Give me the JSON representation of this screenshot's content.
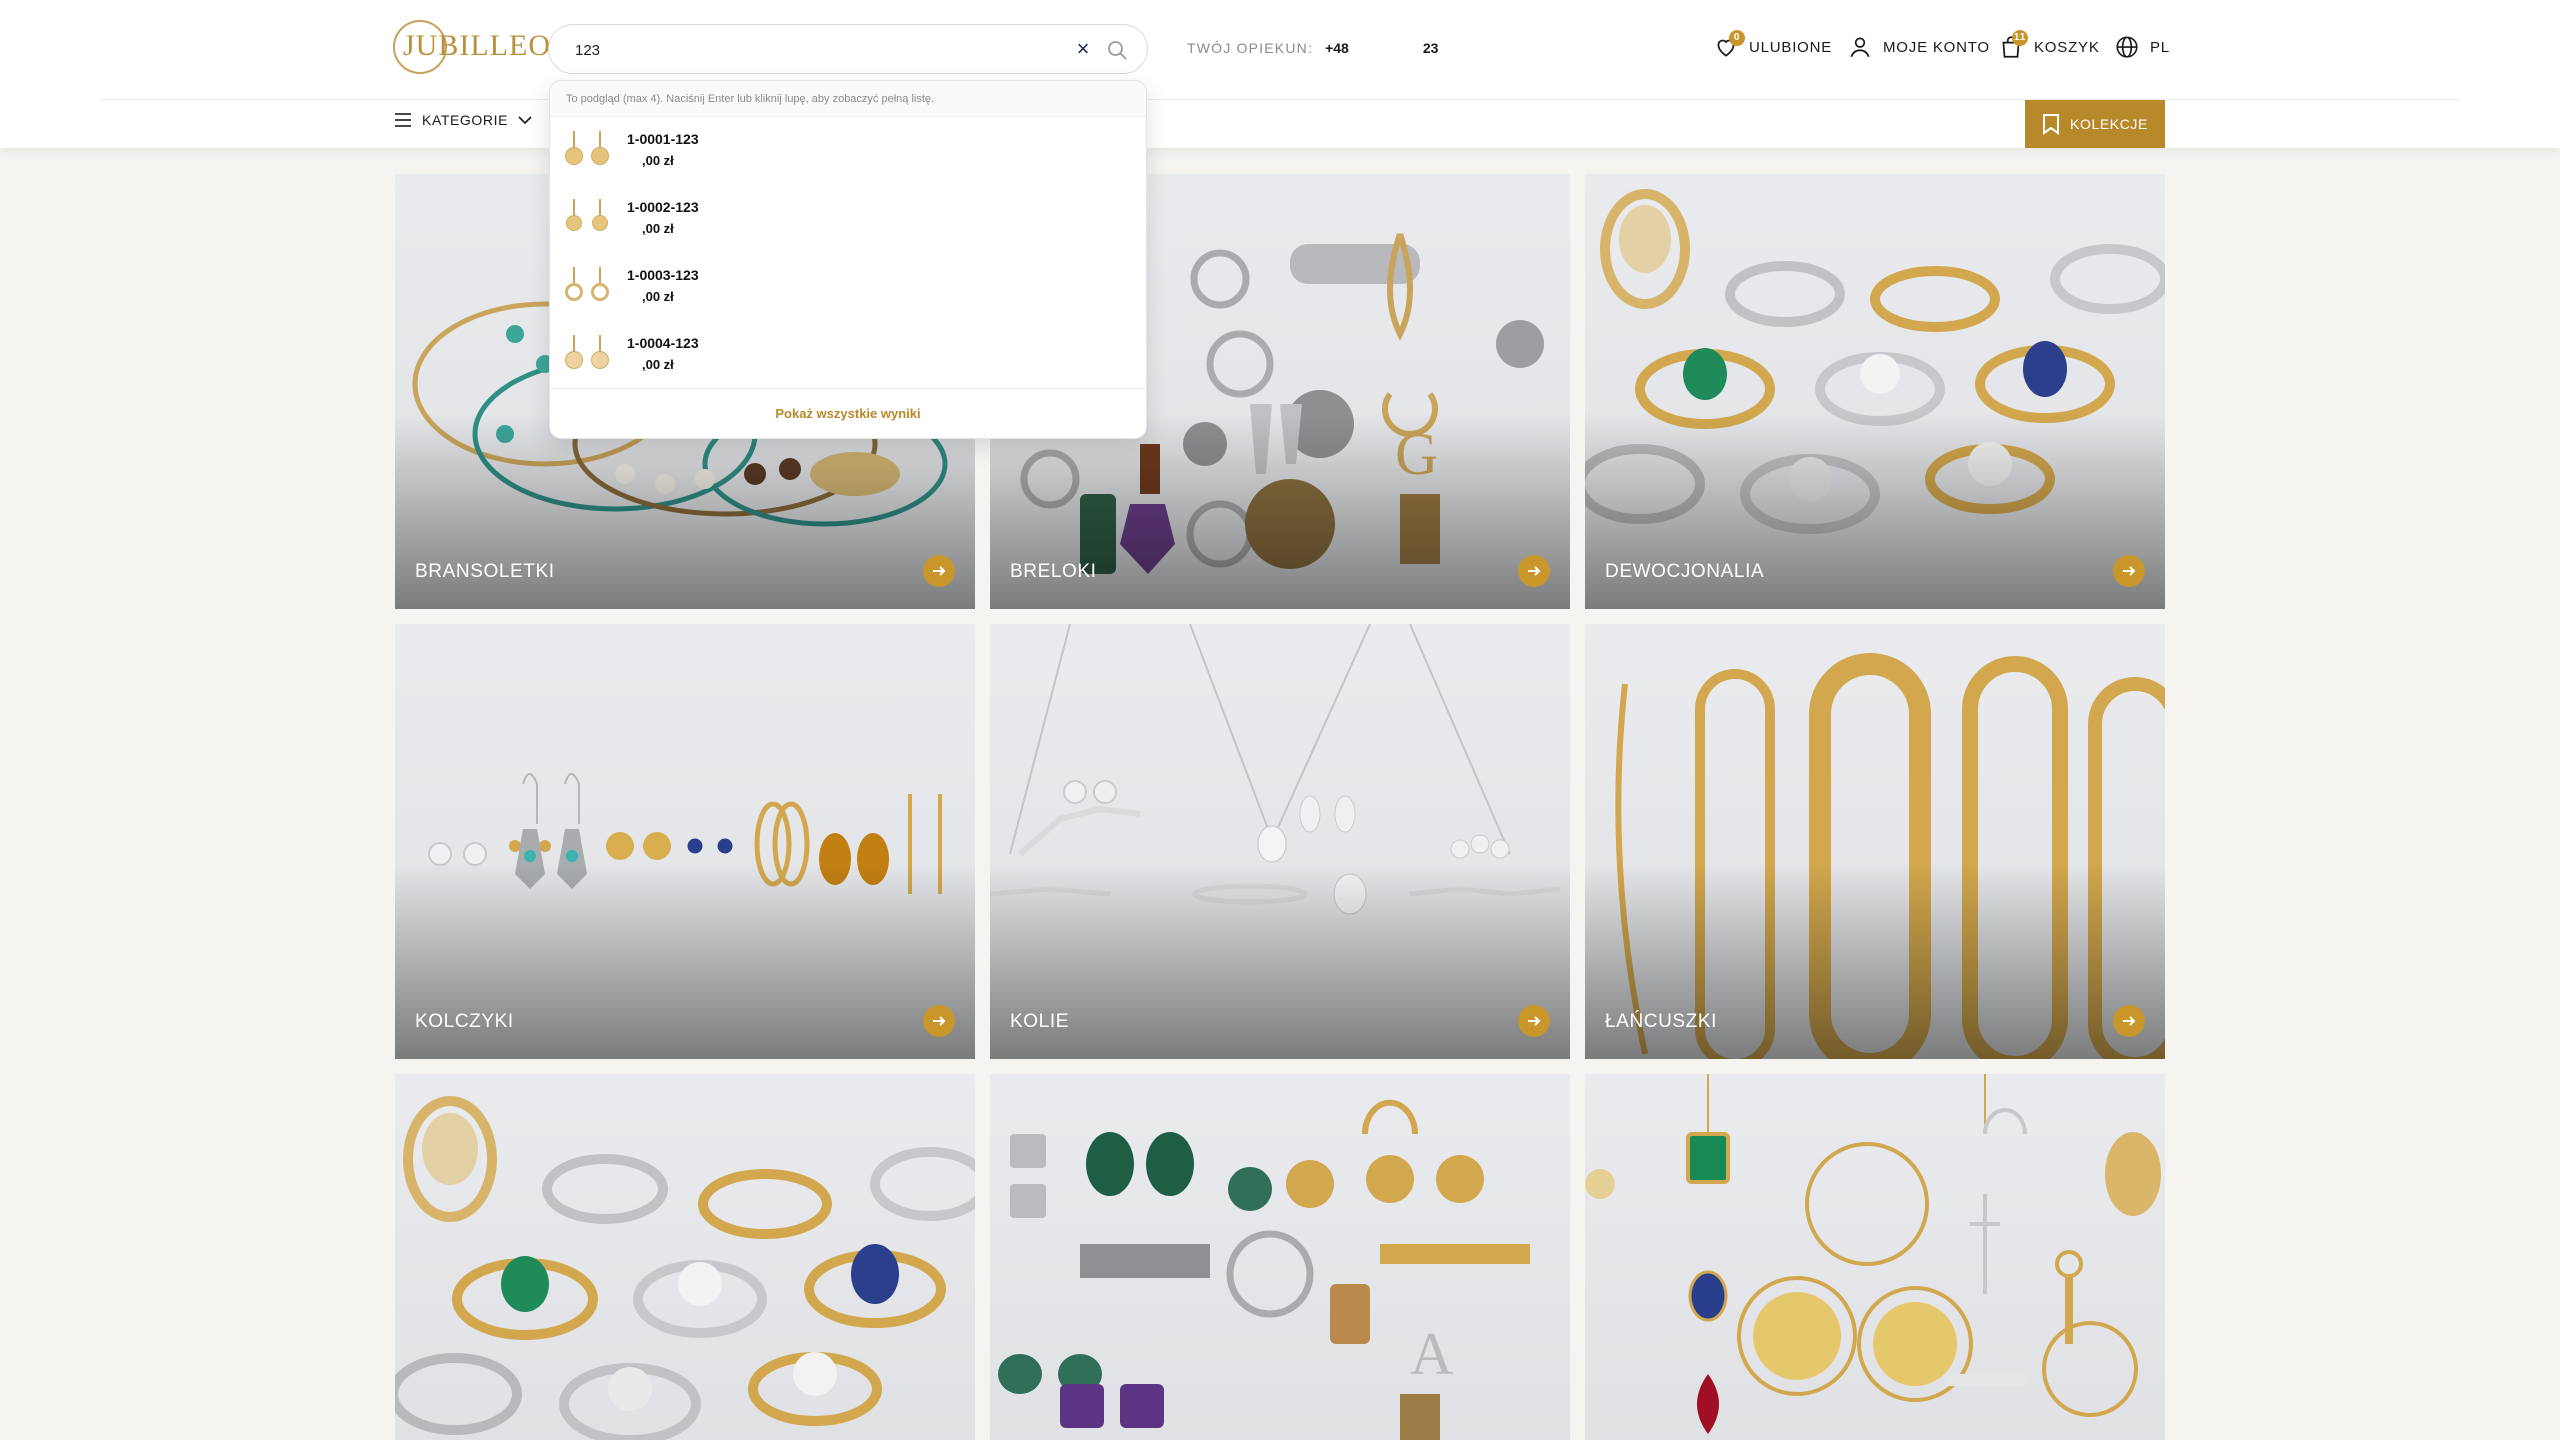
{
  "header": {
    "logo_text": "JUBILLEO",
    "search": {
      "value": "123",
      "placeholder": ""
    },
    "opiekun_label": "TWÓJ OPIEKUN:",
    "opiekun_phone": "+48",
    "opiekun_ext": "23",
    "favorites": {
      "label": "ULUBIONE",
      "count": "0"
    },
    "account_label": "MOJE KONTO",
    "cart": {
      "label": "KOSZYK",
      "count": "11"
    },
    "language": "PL",
    "categories_label": "KATEGORIE",
    "collections_label": "KOLEKCJE"
  },
  "dropdown": {
    "hint": "To podgląd (max 4). Naciśnij Enter lub kliknij lupę, aby zobaczyć pełną listę.",
    "items": [
      {
        "code": "1-0001-123",
        "price": ",00 zł"
      },
      {
        "code": "1-0002-123",
        "price": ",00 zł"
      },
      {
        "code": "1-0003-123",
        "price": ",00 zł"
      },
      {
        "code": "1-0004-123",
        "price": ",00 zł"
      }
    ],
    "show_all": "Pokaż wszystkie wyniki"
  },
  "categories": [
    {
      "label": "BRANSOLETKI"
    },
    {
      "label": "BRELOKI"
    },
    {
      "label": "DEWOCJONALIA"
    },
    {
      "label": "KOLCZYKI"
    },
    {
      "label": "KOLIE"
    },
    {
      "label": "ŁAŃCUSZKI"
    },
    {
      "label": ""
    },
    {
      "label": ""
    },
    {
      "label": ""
    }
  ],
  "colors": {
    "accent": "#b8892a",
    "arrow": "#c9962b",
    "logo": "#b8903f"
  }
}
